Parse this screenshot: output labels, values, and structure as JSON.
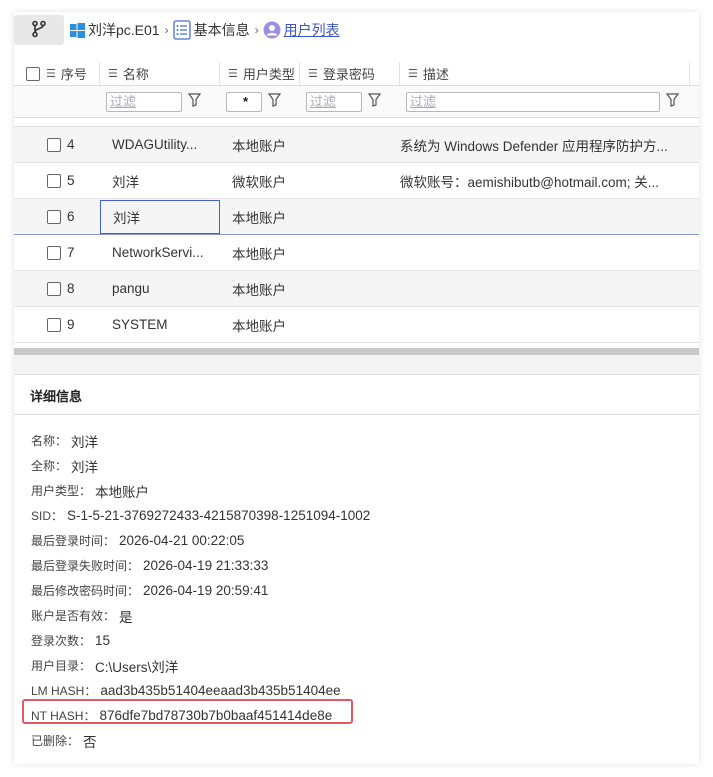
{
  "breadcrumb": {
    "items": [
      {
        "label": "刘洋pc.E01",
        "icon": "windows-icon"
      },
      {
        "label": "基本信息",
        "icon": "list-icon"
      },
      {
        "label": "用户列表",
        "icon": "user-icon"
      }
    ],
    "separator": "›"
  },
  "table": {
    "columns": [
      "序号",
      "名称",
      "用户类型",
      "登录密码",
      "描述"
    ],
    "filters": {
      "placeholder": "过滤",
      "type_value": "*"
    },
    "rows": [
      {
        "idx": "4",
        "name": "WDAGUtility...",
        "type": "本地账户",
        "desc": "系统为 Windows Defender 应用程序防护方..."
      },
      {
        "idx": "5",
        "name": "刘洋",
        "type": "微软账户",
        "desc": "微软账号：aemishibutb@hotmail.com; 关..."
      },
      {
        "idx": "6",
        "name": "刘洋",
        "type": "本地账户",
        "desc": ""
      },
      {
        "idx": "7",
        "name": "NetworkServi...",
        "type": "本地账户",
        "desc": ""
      },
      {
        "idx": "8",
        "name": "pangu",
        "type": "本地账户",
        "desc": ""
      },
      {
        "idx": "9",
        "name": "SYSTEM",
        "type": "本地账户",
        "desc": ""
      }
    ]
  },
  "detail": {
    "title": "详细信息",
    "fields": [
      {
        "k": "名称：",
        "v": "刘洋"
      },
      {
        "k": "全称：",
        "v": "刘洋"
      },
      {
        "k": "用户类型：",
        "v": "本地账户"
      },
      {
        "k": "SID：",
        "v": "S-1-5-21-3769272433-4215870398-1251094-1002"
      },
      {
        "k": "最后登录时间：",
        "v": "2026-04-21 00:22:05"
      },
      {
        "k": "最后登录失败时间：",
        "v": "2026-04-19 21:33:33"
      },
      {
        "k": "最后修改密码时间：",
        "v": "2026-04-19 20:59:41"
      },
      {
        "k": "账户是否有效：",
        "v": "是"
      },
      {
        "k": "登录次数：",
        "v": "15"
      },
      {
        "k": "用户目录：",
        "v": "C:\\Users\\刘洋"
      },
      {
        "k": "LM HASH：",
        "v": "aad3b435b51404eeaad3b435b51404ee"
      },
      {
        "k": "NT HASH：",
        "v": "876dfe7bd78730b7b0baaf451414de8e"
      },
      {
        "k": "已删除：",
        "v": "否"
      }
    ]
  },
  "colors": {
    "accent": "#3d54c8",
    "highlight": "#e05a65"
  }
}
